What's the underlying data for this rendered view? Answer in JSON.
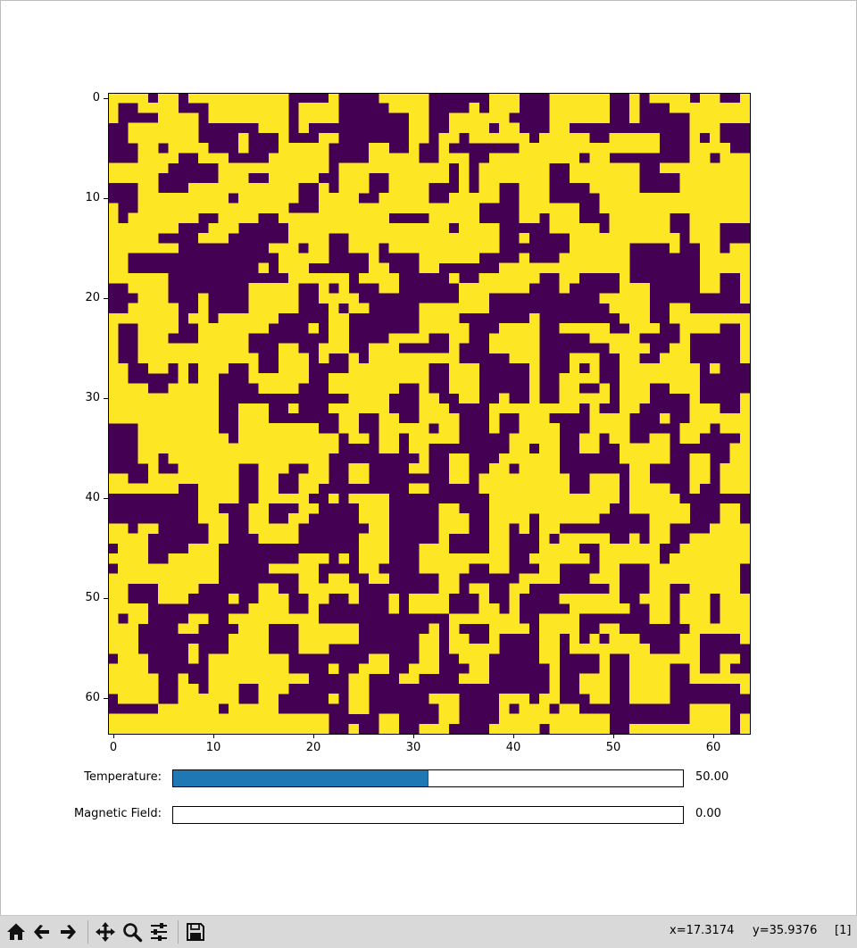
{
  "figure": {
    "x_ticks": [
      "0",
      "10",
      "20",
      "30",
      "40",
      "50",
      "60"
    ],
    "y_ticks": [
      "0",
      "10",
      "20",
      "30",
      "40",
      "50",
      "60"
    ]
  },
  "chart_data": {
    "type": "heatmap",
    "title": "",
    "xlabel": "",
    "ylabel": "",
    "rows": 64,
    "cols": 64,
    "xlim": [
      -0.5,
      63.5
    ],
    "ylim": [
      63.5,
      -0.5
    ],
    "x_ticks": [
      0,
      10,
      20,
      30,
      40,
      50,
      60
    ],
    "y_ticks": [
      0,
      10,
      20,
      30,
      40,
      50,
      60
    ],
    "values_allowed": [
      -1,
      1
    ],
    "colormap": "viridis",
    "color_low": "#440154",
    "color_high": "#fde725",
    "grid": false
  },
  "sliders": [
    {
      "label": "Temperature:",
      "value": "50.00",
      "fraction": 0.5
    },
    {
      "label": "Magnetic Field:",
      "value": "0.00",
      "fraction": 0.0
    }
  ],
  "toolbar": {
    "buttons": [
      "home-icon",
      "back-arrow-icon",
      "forward-arrow-icon",
      "pan-icon",
      "zoom-icon",
      "configure-subplots-icon",
      "save-icon"
    ]
  },
  "status": {
    "x": "x=17.3174",
    "y": "y=35.9376",
    "index": "[1]"
  },
  "colors": {
    "slider_fill": "#1f77b4",
    "slider_handle": "#ff0000",
    "toolbar_bg": "#d9d9d9"
  }
}
